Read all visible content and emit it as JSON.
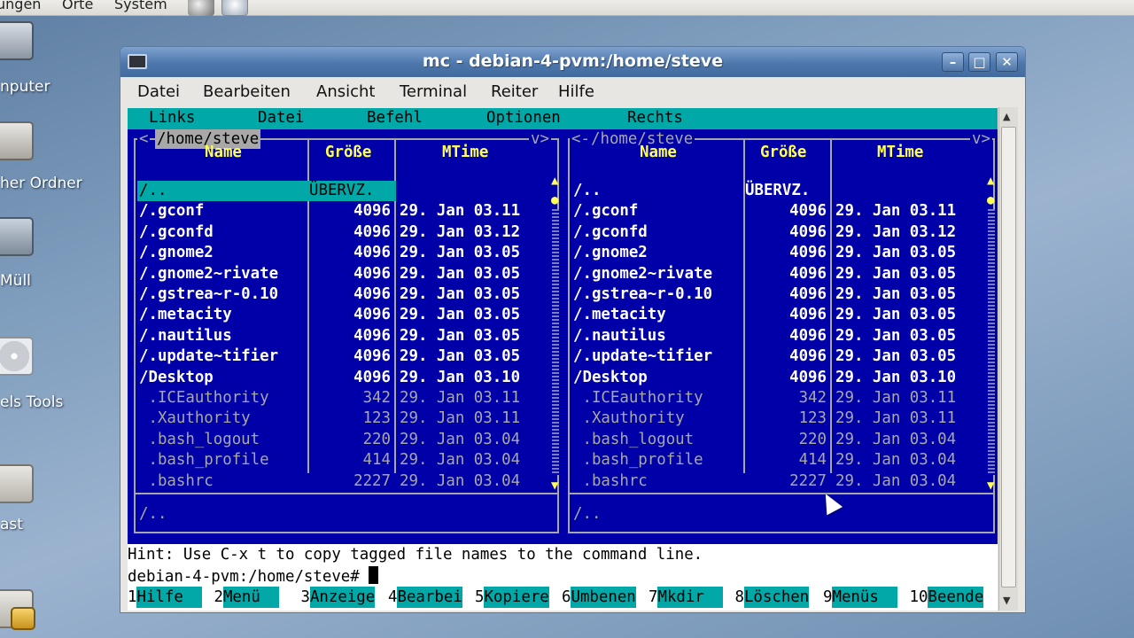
{
  "top_panel": {
    "menus": [
      "ungen",
      "Orte",
      "System"
    ]
  },
  "desktop": {
    "icons": [
      {
        "label": "nputer",
        "icon": "computer-icon"
      },
      {
        "label": "her Ordner",
        "icon": "home-folder-icon"
      },
      {
        "label": "Müll",
        "icon": "trash-icon"
      },
      {
        "label": "els Tools",
        "icon": "cd-icon"
      },
      {
        "label": "ast",
        "icon": "folder-icon"
      },
      {
        "label": "",
        "icon": "lock-icon"
      }
    ]
  },
  "window": {
    "title": "mc - debian-4-pvm:/home/steve",
    "buttons": {
      "minimize": "–",
      "maximize": "□",
      "close": "✕"
    },
    "menu": [
      "Datei",
      "Bearbeiten",
      "Ansicht",
      "Terminal",
      "Reiter",
      "Hilfe"
    ]
  },
  "mc": {
    "menu": [
      "Links",
      "Datei",
      "Befehl",
      "Optionen",
      "Rechts"
    ],
    "left_panel": {
      "path": "/home/steve",
      "left_marker": "<",
      "right_marker": "v>",
      "columns": [
        "Name",
        "Größe",
        "MTime"
      ],
      "mini_status": "/..",
      "rows": [
        {
          "name": "/..",
          "size": "ÜBERVZ.",
          "mtime": "",
          "kind": "sel"
        },
        {
          "name": "/.gconf",
          "size": "4096",
          "mtime": "29. Jan 03.11",
          "kind": "dir"
        },
        {
          "name": "/.gconfd",
          "size": "4096",
          "mtime": "29. Jan 03.12",
          "kind": "dir"
        },
        {
          "name": "/.gnome2",
          "size": "4096",
          "mtime": "29. Jan 03.05",
          "kind": "dir"
        },
        {
          "name": "/.gnome2~rivate",
          "size": "4096",
          "mtime": "29. Jan 03.05",
          "kind": "dir"
        },
        {
          "name": "/.gstrea~r-0.10",
          "size": "4096",
          "mtime": "29. Jan 03.05",
          "kind": "dir"
        },
        {
          "name": "/.metacity",
          "size": "4096",
          "mtime": "29. Jan 03.05",
          "kind": "dir"
        },
        {
          "name": "/.nautilus",
          "size": "4096",
          "mtime": "29. Jan 03.05",
          "kind": "dir"
        },
        {
          "name": "/.update~tifier",
          "size": "4096",
          "mtime": "29. Jan 03.05",
          "kind": "dir"
        },
        {
          "name": "/Desktop",
          "size": "4096",
          "mtime": "29. Jan 03.10",
          "kind": "dir"
        },
        {
          "name": " .ICEauthority",
          "size": "342",
          "mtime": "29. Jan 03.11",
          "kind": "file"
        },
        {
          "name": " .Xauthority",
          "size": "123",
          "mtime": "29. Jan 03.11",
          "kind": "file"
        },
        {
          "name": " .bash_logout",
          "size": "220",
          "mtime": "29. Jan 03.04",
          "kind": "file"
        },
        {
          "name": " .bash_profile",
          "size": "414",
          "mtime": "29. Jan 03.04",
          "kind": "file"
        },
        {
          "name": " .bashrc",
          "size": "2227",
          "mtime": "29. Jan 03.04",
          "kind": "file"
        }
      ]
    },
    "right_panel": {
      "path": "/home/steve",
      "left_marker": "<-",
      "right_marker": "v>",
      "columns": [
        "Name",
        "Größe",
        "MTime"
      ],
      "mini_status": "/..",
      "rows": [
        {
          "name": "/..",
          "size": "ÜBERVZ.",
          "mtime": "",
          "kind": "dir"
        },
        {
          "name": "/.gconf",
          "size": "4096",
          "mtime": "29. Jan 03.11",
          "kind": "dir"
        },
        {
          "name": "/.gconfd",
          "size": "4096",
          "mtime": "29. Jan 03.12",
          "kind": "dir"
        },
        {
          "name": "/.gnome2",
          "size": "4096",
          "mtime": "29. Jan 03.05",
          "kind": "dir"
        },
        {
          "name": "/.gnome2~rivate",
          "size": "4096",
          "mtime": "29. Jan 03.05",
          "kind": "dir"
        },
        {
          "name": "/.gstrea~r-0.10",
          "size": "4096",
          "mtime": "29. Jan 03.05",
          "kind": "dir"
        },
        {
          "name": "/.metacity",
          "size": "4096",
          "mtime": "29. Jan 03.05",
          "kind": "dir"
        },
        {
          "name": "/.nautilus",
          "size": "4096",
          "mtime": "29. Jan 03.05",
          "kind": "dir"
        },
        {
          "name": "/.update~tifier",
          "size": "4096",
          "mtime": "29. Jan 03.05",
          "kind": "dir"
        },
        {
          "name": "/Desktop",
          "size": "4096",
          "mtime": "29. Jan 03.10",
          "kind": "dir"
        },
        {
          "name": " .ICEauthority",
          "size": "342",
          "mtime": "29. Jan 03.11",
          "kind": "file"
        },
        {
          "name": " .Xauthority",
          "size": "123",
          "mtime": "29. Jan 03.11",
          "kind": "file"
        },
        {
          "name": " .bash_logout",
          "size": "220",
          "mtime": "29. Jan 03.04",
          "kind": "file"
        },
        {
          "name": " .bash_profile",
          "size": "414",
          "mtime": "29. Jan 03.04",
          "kind": "file"
        },
        {
          "name": " .bashrc",
          "size": "2227",
          "mtime": "29. Jan 03.04",
          "kind": "file"
        }
      ]
    },
    "hint": "Hint: Use C-x t to copy tagged file names to the command line.",
    "prompt": "debian-4-pvm:/home/steve# ",
    "fkeys": [
      {
        "num": "1",
        "label": "Hilfe  "
      },
      {
        "num": " 2",
        "label": "Menü  "
      },
      {
        "num": " 3",
        "label": "Anzeige"
      },
      {
        "num": "4",
        "label": "Bearbei"
      },
      {
        "num": "5",
        "label": "Kopiere"
      },
      {
        "num": "6",
        "label": "Umbenen"
      },
      {
        "num": "7",
        "label": "Mkdir  "
      },
      {
        "num": " 8",
        "label": "Löschen"
      },
      {
        "num": "9",
        "label": "Menüs  "
      },
      {
        "num": " 10",
        "label": "Beende"
      }
    ]
  },
  "colors": {
    "panel_bg": "#0000a8",
    "accent_cyan": "#00a8a8",
    "header_yellow": "#ffff54",
    "titlebar_blue": "#4d77ac"
  }
}
